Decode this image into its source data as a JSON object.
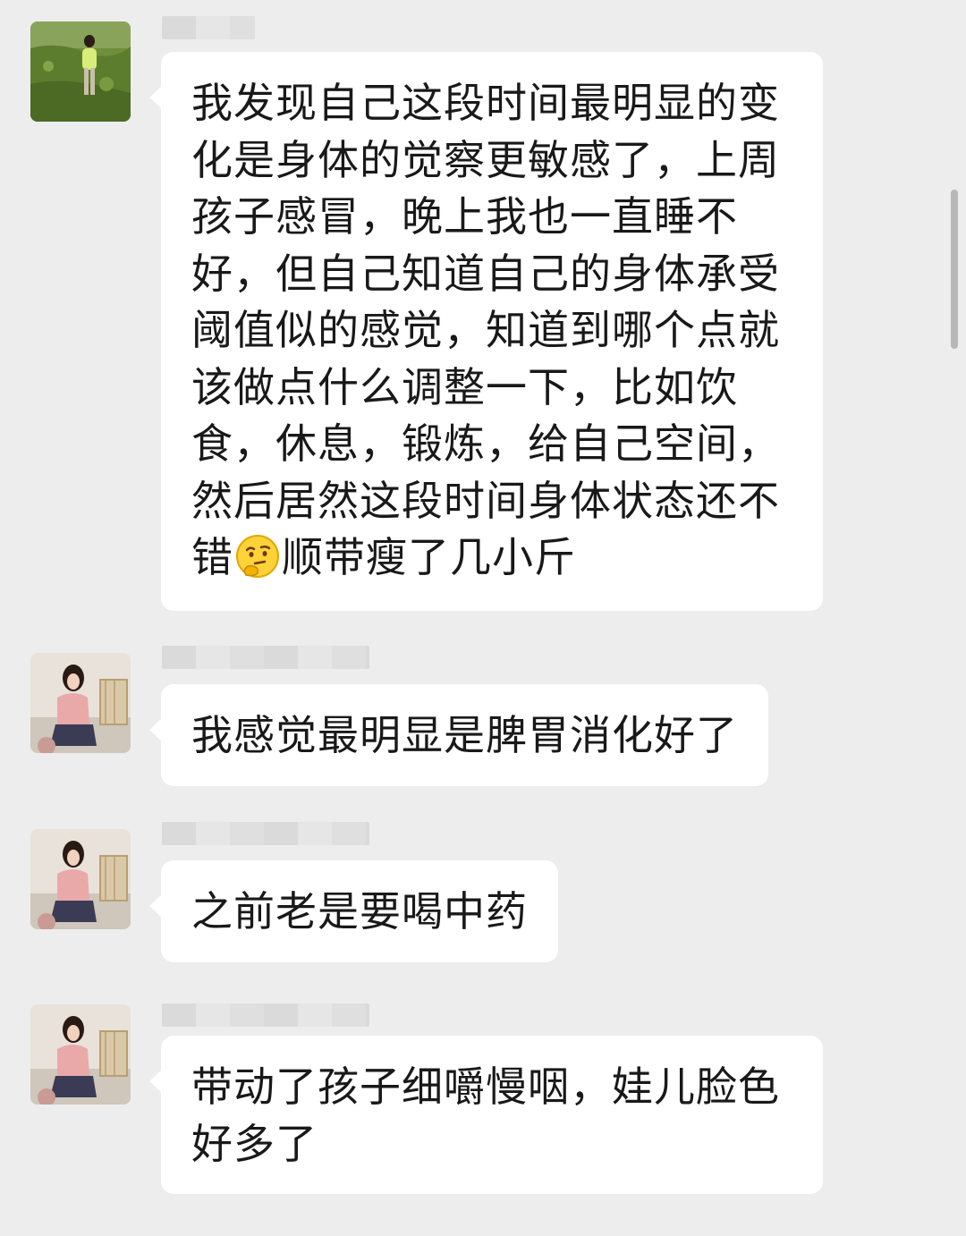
{
  "messages": [
    {
      "sender": "",
      "lines": [
        "我发现自己这段时间最明显的变",
        "化是身体的觉察更敏感了，上周",
        "孩子感冒，晚上我也一直睡不",
        "好，但自己知道自己的身体承受",
        "阈值似的感觉，知道到哪个点就",
        "该做点什么调整一下，比如饮",
        "食，休息，锻炼，给自己空间，",
        "然后居然这段时间身体状态还不"
      ],
      "last_line_before_emoji": "错",
      "emoji": "thinking-face-icon",
      "last_line_after_emoji": "顺带瘦了几小斤"
    },
    {
      "sender": "",
      "text": "我感觉最明显是脾胃消化好了"
    },
    {
      "sender": "",
      "text": "之前老是要喝中药"
    },
    {
      "sender": "",
      "text": "带动了孩子细嚼慢咽，娃儿脸色\n好多了"
    }
  ],
  "colors": {
    "background": "#ededed",
    "bubble": "#ffffff",
    "text": "#191919"
  }
}
